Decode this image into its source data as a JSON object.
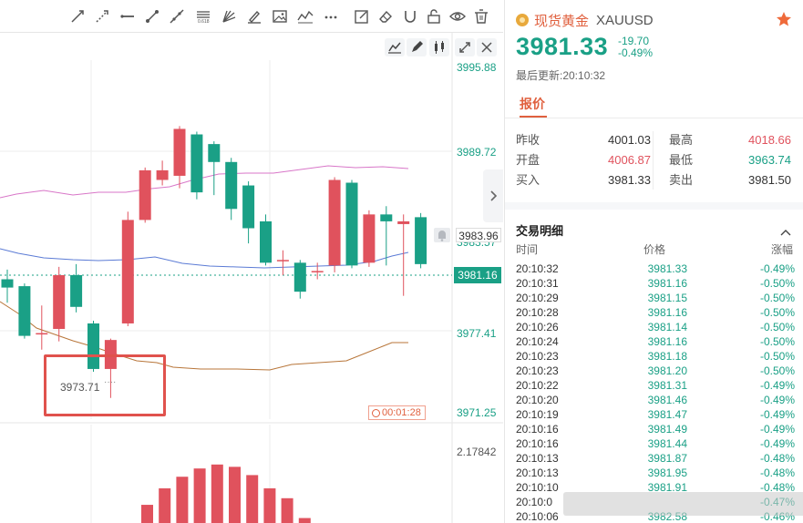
{
  "colors": {
    "up": "#e0525d",
    "down": "#1aa086",
    "accent": "#e0603e"
  },
  "chart": {
    "price_axis_labels": [
      "3995.88",
      "3989.72",
      "3983.57",
      "3977.41",
      "3971.25"
    ],
    "current_price_tag": "3981.16",
    "crosshair_price_tag": "3983.96",
    "low_marker": "3973.71",
    "low_marker_dots": "····",
    "countdown": "00:01:28",
    "indicator_axis_label": "2.17842",
    "toolbar_icons": [
      "trend-line-icon",
      "ray-icon",
      "horizontal-line-icon",
      "segment-icon",
      "extended-line-icon",
      "fib-icon",
      "gann-fan-icon",
      "brush-icon",
      "image-icon",
      "wave-icon",
      "more-icon",
      "note-icon",
      "eraser-icon",
      "magnet-icon",
      "lock-icon",
      "eye-icon",
      "trash-icon"
    ],
    "sub_toolbar_icons": [
      "indicator-icon",
      "draw-icon",
      "compare-icon",
      "expand-icon",
      "close-icon"
    ]
  },
  "chart_data": {
    "type": "candlestick",
    "y_range": [
      3969.5,
      3997.5
    ],
    "candles": [
      {
        "o": 3979.9,
        "c": 3979.3,
        "h": 3980.6,
        "l": 3978.2
      },
      {
        "o": 3979.4,
        "c": 3975.8,
        "h": 3979.6,
        "l": 3975.6
      },
      {
        "o": 3976.0,
        "c": 3976.0,
        "h": 3978.0,
        "l": 3974.8
      },
      {
        "o": 3976.3,
        "c": 3980.2,
        "h": 3980.8,
        "l": 3975.4
      },
      {
        "o": 3980.2,
        "c": 3977.9,
        "h": 3981.0,
        "l": 3977.5
      },
      {
        "o": 3976.7,
        "c": 3973.4,
        "h": 3976.9,
        "l": 3973.2
      },
      {
        "o": 3973.4,
        "c": 3975.5,
        "h": 3975.6,
        "l": 3971.3
      },
      {
        "o": 3976.7,
        "c": 3984.2,
        "h": 3984.8,
        "l": 3976.5
      },
      {
        "o": 3984.2,
        "c": 3987.8,
        "h": 3988.0,
        "l": 3984.0
      },
      {
        "o": 3987.1,
        "c": 3987.8,
        "h": 3988.5,
        "l": 3986.7
      },
      {
        "o": 3987.4,
        "c": 3990.8,
        "h": 3991.0,
        "l": 3986.5
      },
      {
        "o": 3990.4,
        "c": 3986.2,
        "h": 3990.6,
        "l": 3985.7
      },
      {
        "o": 3989.7,
        "c": 3988.4,
        "h": 3989.9,
        "l": 3986.0
      },
      {
        "o": 3988.4,
        "c": 3985.0,
        "h": 3988.7,
        "l": 3984.2
      },
      {
        "o": 3986.7,
        "c": 3983.6,
        "h": 3987.0,
        "l": 3982.5
      },
      {
        "o": 3984.1,
        "c": 3981.1,
        "h": 3984.6,
        "l": 3980.9
      },
      {
        "o": 3981.3,
        "c": 3981.3,
        "h": 3982.0,
        "l": 3980.2
      },
      {
        "o": 3981.1,
        "c": 3979.0,
        "h": 3981.3,
        "l": 3978.5
      },
      {
        "o": 3980.5,
        "c": 3980.5,
        "h": 3981.1,
        "l": 3979.9
      },
      {
        "o": 3980.9,
        "c": 3987.1,
        "h": 3987.3,
        "l": 3980.4
      },
      {
        "o": 3986.9,
        "c": 3980.9,
        "h": 3987.1,
        "l": 3980.7
      },
      {
        "o": 3981.1,
        "c": 3984.6,
        "h": 3984.9,
        "l": 3980.8
      },
      {
        "o": 3984.6,
        "c": 3984.1,
        "h": 3985.2,
        "l": 3980.9
      },
      {
        "o": 3983.9,
        "c": 3984.1,
        "h": 3984.6,
        "l": 3978.7
      },
      {
        "o": 3984.4,
        "c": 3981.0,
        "h": 3984.7,
        "l": 3980.7
      }
    ],
    "macd_bars": [
      0.55,
      1.05,
      1.4,
      1.65,
      1.77,
      1.7,
      1.45,
      1.05,
      0.75,
      0.15
    ],
    "macd_max": 2.17842
  },
  "quote": {
    "name": "现货黄金",
    "code": "XAUUSD",
    "price": "3981.33",
    "change": "-19.70",
    "change_pct": "-0.49%",
    "updated": "最后更新:20:10:32",
    "tab": "报价",
    "stats": [
      {
        "k1": "昨收",
        "v1": "4001.03",
        "k2": "最高",
        "v2": "4018.66",
        "v2_color": "#e0525d"
      },
      {
        "k1": "开盘",
        "v1": "4006.87",
        "k2": "最低",
        "v2": "3963.74",
        "v2_color": "#1aa086"
      },
      {
        "k1": "买入",
        "v1": "3981.33",
        "k2": "卖出",
        "v2": "3981.50",
        "v2_color": "#333333"
      }
    ],
    "stat_v1_colors": [
      "#333333",
      "#e0525d",
      "#333333"
    ],
    "trades_title": "交易明细",
    "headers": [
      "时间",
      "价格",
      "涨幅"
    ],
    "trades": [
      {
        "t": "20:10:32",
        "p": "3981.33",
        "c": "-0.49%"
      },
      {
        "t": "20:10:31",
        "p": "3981.16",
        "c": "-0.50%"
      },
      {
        "t": "20:10:29",
        "p": "3981.15",
        "c": "-0.50%"
      },
      {
        "t": "20:10:28",
        "p": "3981.16",
        "c": "-0.50%"
      },
      {
        "t": "20:10:26",
        "p": "3981.14",
        "c": "-0.50%"
      },
      {
        "t": "20:10:24",
        "p": "3981.16",
        "c": "-0.50%"
      },
      {
        "t": "20:10:23",
        "p": "3981.18",
        "c": "-0.50%"
      },
      {
        "t": "20:10:23",
        "p": "3981.20",
        "c": "-0.50%"
      },
      {
        "t": "20:10:22",
        "p": "3981.31",
        "c": "-0.49%"
      },
      {
        "t": "20:10:20",
        "p": "3981.46",
        "c": "-0.49%"
      },
      {
        "t": "20:10:19",
        "p": "3981.47",
        "c": "-0.49%"
      },
      {
        "t": "20:10:16",
        "p": "3981.49",
        "c": "-0.49%"
      },
      {
        "t": "20:10:16",
        "p": "3981.44",
        "c": "-0.49%"
      },
      {
        "t": "20:10:13",
        "p": "3981.87",
        "c": "-0.48%"
      },
      {
        "t": "20:10:13",
        "p": "3981.95",
        "c": "-0.48%"
      },
      {
        "t": "20:10:10",
        "p": "3981.91",
        "c": "-0.48%"
      },
      {
        "t": "20:10:0",
        "p": "",
        "c": "-0.47%"
      },
      {
        "t": "20:10:06",
        "p": "3982.58",
        "c": "-0.46%"
      }
    ]
  }
}
